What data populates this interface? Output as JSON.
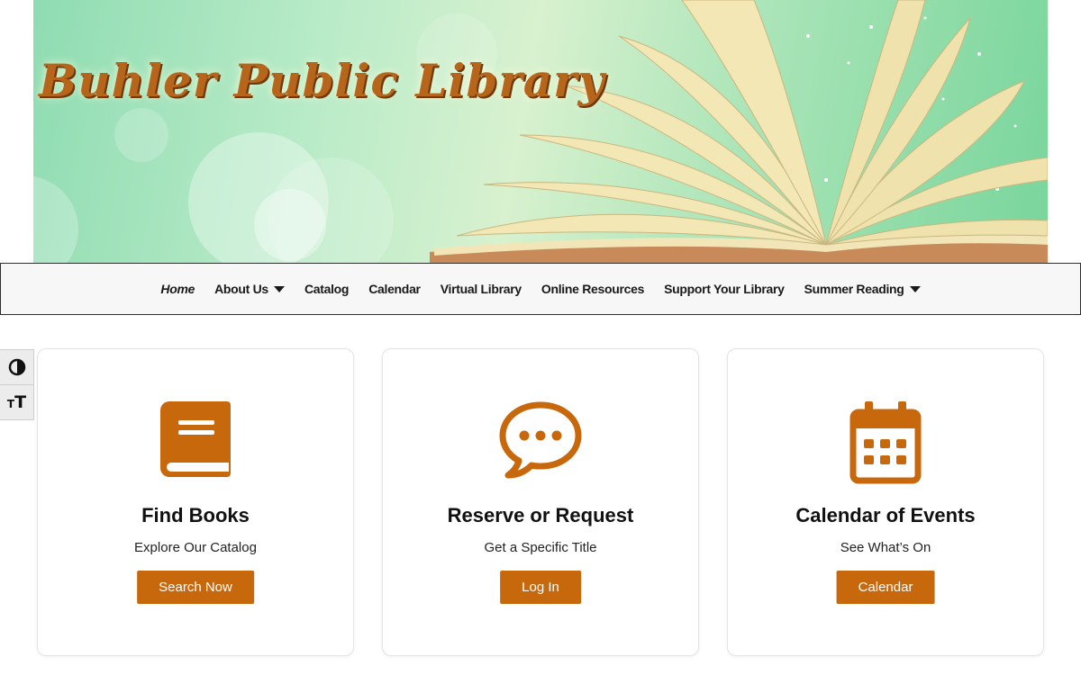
{
  "site": {
    "title": "Buhler Public Library"
  },
  "nav": {
    "items": [
      {
        "label": "Home",
        "active": true,
        "dropdown": false
      },
      {
        "label": "About Us",
        "active": false,
        "dropdown": true
      },
      {
        "label": "Catalog",
        "active": false,
        "dropdown": false
      },
      {
        "label": "Calendar",
        "active": false,
        "dropdown": false
      },
      {
        "label": "Virtual Library",
        "active": false,
        "dropdown": false
      },
      {
        "label": "Online Resources",
        "active": false,
        "dropdown": false
      },
      {
        "label": "Support Your Library",
        "active": false,
        "dropdown": false
      },
      {
        "label": "Summer Reading",
        "active": false,
        "dropdown": true
      }
    ]
  },
  "accessibility": {
    "contrast_icon": "contrast-icon",
    "font_resize_icon": "font-resize-icon"
  },
  "cards": [
    {
      "icon": "book-icon",
      "title": "Find Books",
      "subtitle": "Explore Our Catalog",
      "button": "Search Now"
    },
    {
      "icon": "comment-icon",
      "title": "Reserve or Request",
      "subtitle": "Get a Specific Title",
      "button": "Log In"
    },
    {
      "icon": "calendar-icon",
      "title": "Calendar of Events",
      "subtitle": "See What’s On",
      "button": "Calendar"
    }
  ],
  "colors": {
    "accent": "#c8680c",
    "banner_green": "#a9e4b7",
    "title_brown": "#b8651c",
    "nav_background": "#f7f7f7"
  }
}
